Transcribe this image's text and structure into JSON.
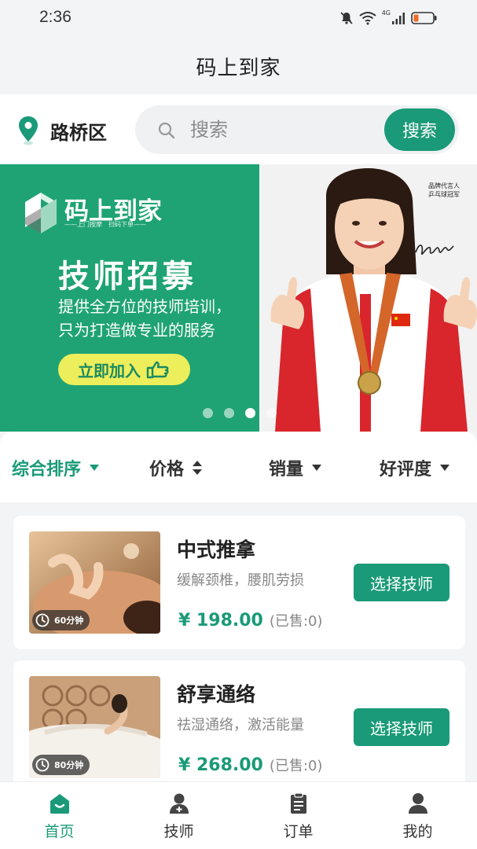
{
  "status_bar": {
    "time": "2:36",
    "network": "4G",
    "icons": [
      "mute-bell-icon",
      "wifi-icon",
      "signal-icon",
      "battery-low-icon"
    ]
  },
  "header": {
    "title": "码上到家"
  },
  "location": {
    "district": "路桥区",
    "icon": "location-pin-icon"
  },
  "search": {
    "placeholder": "搜索",
    "button_label": "搜索"
  },
  "banner": {
    "brand_name": "码上到家",
    "brand_tagline": "——上门按摩　扫码下单——",
    "headline": "技师招募",
    "desc_line1": "提供全方位的技师培训，",
    "desc_line2": "只为打造做专业的服务",
    "join_label": "立即加入",
    "endorse_label": "品牌代言人 乒乓球冠军",
    "total_slides": 4,
    "active_slide": 3
  },
  "sort": {
    "items": [
      {
        "label": "综合排序",
        "icon": "caret-down-icon",
        "active": true
      },
      {
        "label": "价格",
        "icon": "sort-updown-icon",
        "active": false
      },
      {
        "label": "销量",
        "icon": "caret-down-icon",
        "active": false
      },
      {
        "label": "好评度",
        "icon": "caret-down-icon",
        "active": false
      }
    ]
  },
  "services": [
    {
      "name": "中式推拿",
      "desc": "缓解颈椎，腰肌劳损",
      "price": "¥ 198.00",
      "sold": "(已售:0)",
      "duration": "60分钟",
      "button_label": "选择技师"
    },
    {
      "name": "舒享通络",
      "desc": "祛湿通络，激活能量",
      "price": "¥ 268.00",
      "sold": "(已售:0)",
      "duration": "80分钟",
      "button_label": "选择技师"
    }
  ],
  "tabs": [
    {
      "label": "首页",
      "icon": "home-icon",
      "active": true
    },
    {
      "label": "技师",
      "icon": "technician-icon",
      "active": false
    },
    {
      "label": "订单",
      "icon": "order-clipboard-icon",
      "active": false
    },
    {
      "label": "我的",
      "icon": "user-profile-icon",
      "active": false
    }
  ],
  "colors": {
    "brand_green": "#1a9a78",
    "banner_green": "#1fa374",
    "join_yellow": "#ecee5b"
  }
}
